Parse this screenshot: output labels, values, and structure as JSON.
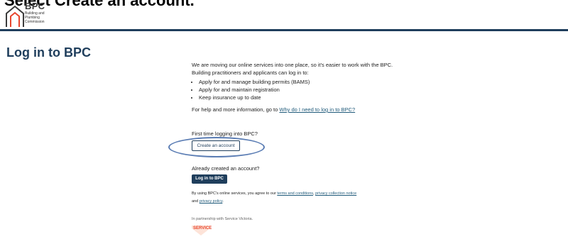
{
  "instruction": "Select Create an account.",
  "logo": {
    "name": "BPC",
    "subtitle_lines": [
      "Building and",
      "Plumbing",
      "Commission"
    ]
  },
  "page_title": "Log in to BPC",
  "content": {
    "intro": "We are moving our online services into one place, so it's easier to work with the BPC. Building practitioners and applicants can log in to:",
    "bullets": [
      "Apply for and manage building permits (BAMS)",
      "Apply for and maintain registration",
      "Keep insurance up to date"
    ],
    "help_prefix": "For help and more information, go to ",
    "help_link": "Why do I need to log in to BPC?"
  },
  "first_time_label": "First time logging into BPC?",
  "create_account_button": "Create an account",
  "already_label": "Already created an account?",
  "login_button": "Log in to BPC",
  "terms": {
    "prefix": "By using BPC's online services, you agree to our ",
    "terms_link": "terms and conditions",
    "sep": ", ",
    "privacy_notice_link": "privacy collection notice",
    "and": "and ",
    "privacy_policy_link": "privacy policy",
    "end": "."
  },
  "partnership": "In partnership with Service Victoria.",
  "service_logo_text": "SERVICE",
  "colors": {
    "primary": "#1f3e5c",
    "accent": "#e8462e",
    "highlight": "#5b7db4"
  }
}
